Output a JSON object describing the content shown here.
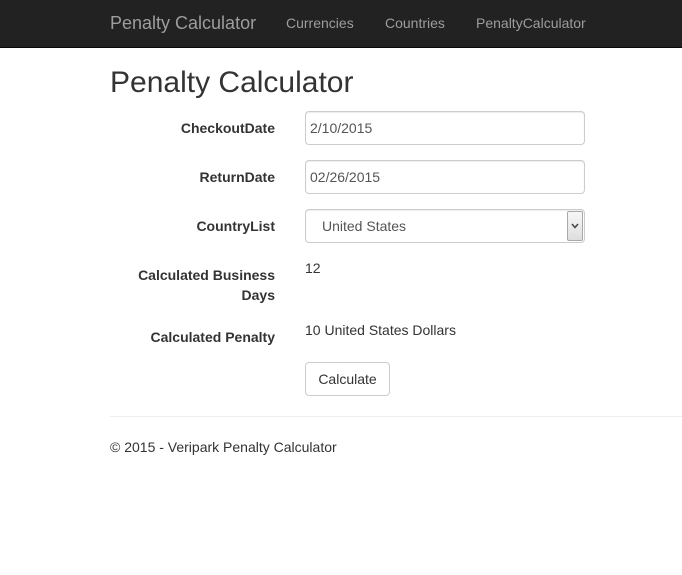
{
  "navbar": {
    "brand": "Penalty Calculator",
    "links": [
      "Currencies",
      "Countries",
      "PenaltyCalculator"
    ]
  },
  "page": {
    "title": "Penalty Calculator"
  },
  "form": {
    "checkout_label": "CheckoutDate",
    "checkout_value": "2/10/2015",
    "return_label": "ReturnDate",
    "return_value": "02/26/2015",
    "country_label": "CountryList",
    "country_value": "United States",
    "business_days_label_line1": "Calculated Business",
    "business_days_label_line2": "Days",
    "business_days_value": "12",
    "penalty_label": "Calculated Penalty",
    "penalty_value": "10 United States Dollars",
    "calculate_button": "Calculate"
  },
  "footer": {
    "text": "© 2015 - Veripark Penalty Calculator"
  },
  "colors": {
    "navbar_bg": "#222222",
    "navbar_text": "#9d9d9d",
    "text": "#333333"
  }
}
